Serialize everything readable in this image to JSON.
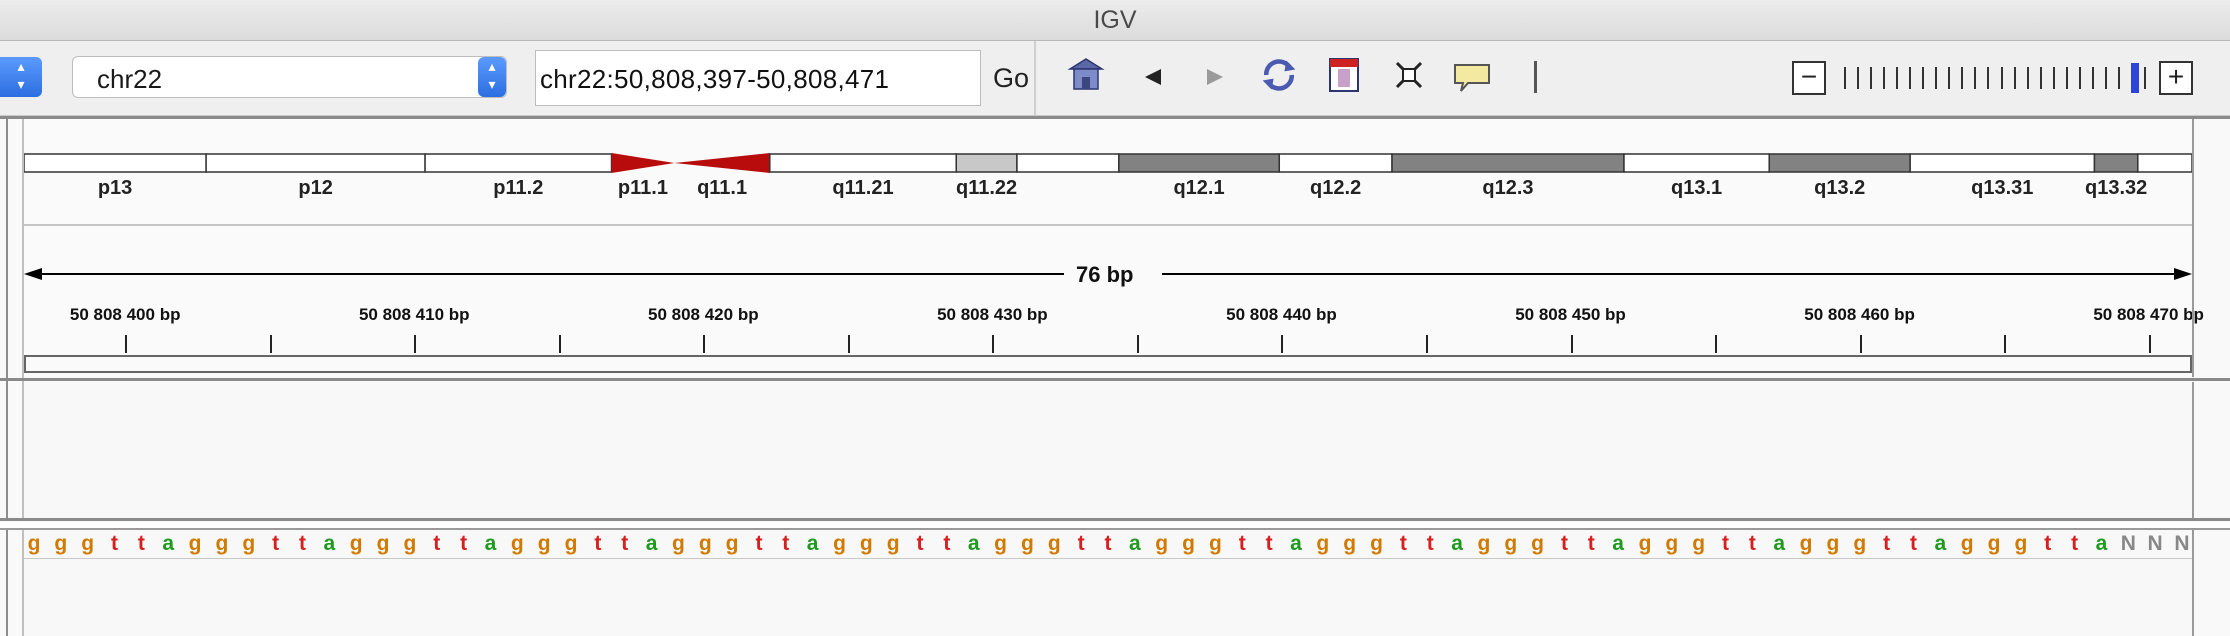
{
  "window": {
    "title": "IGV"
  },
  "toolbar": {
    "genome_stepper_icon": "up-down-arrows-icon",
    "chromosome": {
      "selected": "chr22",
      "stepper_icon": "up-down-arrows-icon"
    },
    "locus": {
      "value": "chr22:50,808,397-50,808,471"
    },
    "go_label": "Go",
    "buttons": [
      {
        "name": "home-icon"
      },
      {
        "name": "back-arrow-icon"
      },
      {
        "name": "forward-arrow-icon"
      },
      {
        "name": "refresh-icon"
      },
      {
        "name": "region-of-interest-icon"
      },
      {
        "name": "resize-icon"
      },
      {
        "name": "popup-info-icon"
      },
      {
        "name": "ruler-toggle-icon"
      }
    ],
    "zoom": {
      "minus": "−",
      "plus": "+",
      "levels": 24,
      "current_level": 23
    }
  },
  "cytoband": {
    "bands": [
      {
        "name": "p13",
        "start": 0.0,
        "end": 0.084,
        "stain": "gneg"
      },
      {
        "name": "p12",
        "start": 0.084,
        "end": 0.185,
        "stain": "gneg"
      },
      {
        "name": "p11.2",
        "start": 0.185,
        "end": 0.271,
        "stain": "gneg"
      },
      {
        "name": "p11.1",
        "start": 0.271,
        "end": 0.3,
        "stain": "acen"
      },
      {
        "name": "q11.1",
        "start": 0.3,
        "end": 0.344,
        "stain": "acen"
      },
      {
        "name": "q11.21",
        "start": 0.344,
        "end": 0.43,
        "stain": "gneg"
      },
      {
        "name": "q11.22",
        "start": 0.43,
        "end": 0.458,
        "stain": "gpos25"
      },
      {
        "name": "",
        "start": 0.458,
        "end": 0.505,
        "stain": "gneg"
      },
      {
        "name": "q12.1",
        "start": 0.505,
        "end": 0.579,
        "stain": "gpos75"
      },
      {
        "name": "q12.2",
        "start": 0.579,
        "end": 0.631,
        "stain": "gneg"
      },
      {
        "name": "q12.3",
        "start": 0.631,
        "end": 0.738,
        "stain": "gpos75"
      },
      {
        "name": "q13.1",
        "start": 0.738,
        "end": 0.805,
        "stain": "gneg"
      },
      {
        "name": "q13.2",
        "start": 0.805,
        "end": 0.87,
        "stain": "gpos75"
      },
      {
        "name": "q13.31",
        "start": 0.87,
        "end": 0.955,
        "stain": "gneg"
      },
      {
        "name": "q13.32",
        "start": 0.955,
        "end": 0.975,
        "stain": "gpos75"
      },
      {
        "name": "",
        "start": 0.975,
        "end": 1.0,
        "stain": "gneg"
      }
    ],
    "colors": {
      "gneg": "#ffffff",
      "gpos25": "#c8c8c8",
      "gpos75": "#828282",
      "acen": "#b80c0c",
      "border": "#333333"
    }
  },
  "ruler": {
    "span_label": "76 bp",
    "view_start": 50808396.5,
    "view_end": 50808471.5,
    "major_ticks": [
      {
        "pos": 50808400,
        "label": "50 808 400 bp"
      },
      {
        "pos": 50808410,
        "label": "50 808 410 bp"
      },
      {
        "pos": 50808420,
        "label": "50 808 420 bp"
      },
      {
        "pos": 50808430,
        "label": "50 808 430 bp"
      },
      {
        "pos": 50808440,
        "label": "50 808 440 bp"
      },
      {
        "pos": 50808450,
        "label": "50 808 450 bp"
      },
      {
        "pos": 50808460,
        "label": "50 808 460 bp"
      },
      {
        "pos": 50808470,
        "label": "50 808 470 bp"
      }
    ],
    "minor_ticks": [
      50808405,
      50808415,
      50808425,
      50808435,
      50808445,
      50808455,
      50808465
    ]
  },
  "sequence": {
    "bases": "gggttagggttagggttagggttagggttagggttagggttagggttagggttagggttagggttagggttagggttaNNN",
    "colors": {
      "a": "#1e9a1e",
      "c": "#1e3ec8",
      "g": "#d17a00",
      "t": "#d62020",
      "N": "#888888"
    }
  }
}
